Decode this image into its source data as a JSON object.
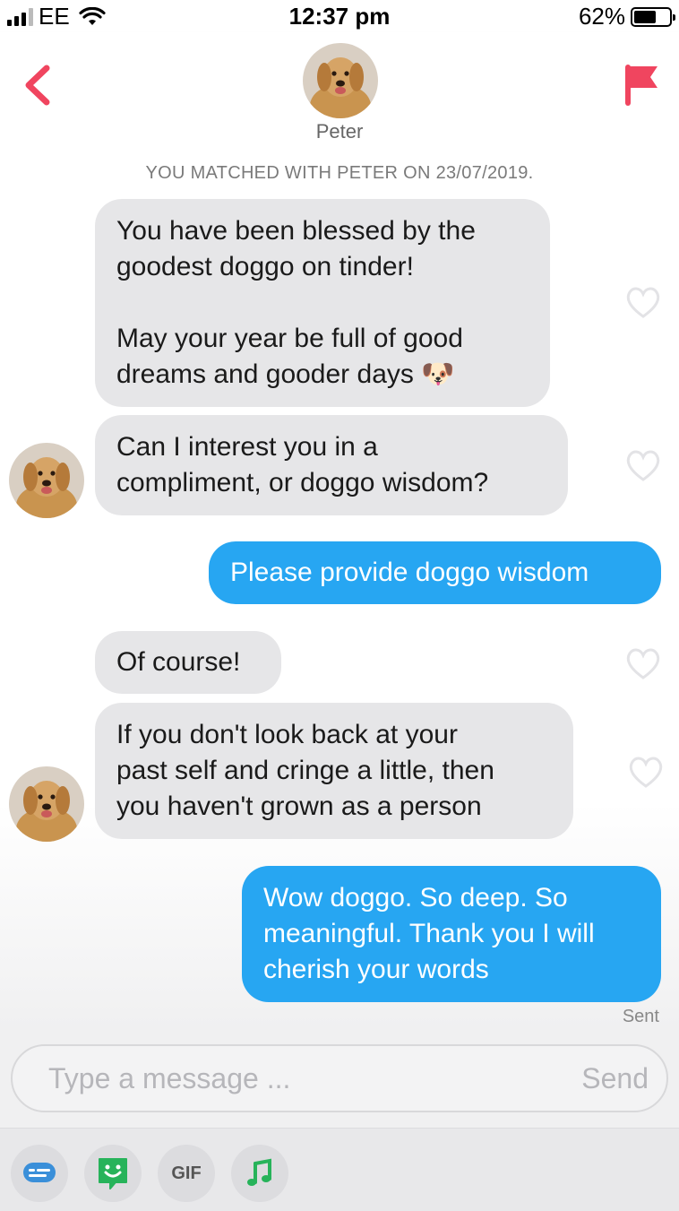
{
  "status_bar": {
    "carrier": "EE",
    "time": "12:37 pm",
    "battery": "62%",
    "battery_level": 0.62
  },
  "header": {
    "back_icon": "chevron-left-icon",
    "flag_icon": "flag-icon",
    "profile_name": "Peter",
    "accent_color": "#f0455f"
  },
  "chat": {
    "match_notice": "YOU MATCHED WITH PETER ON 23/07/2019.",
    "messages": [
      {
        "direction": "in",
        "lines": [
          "You have been blessed by the",
          "goodest doggo on tinder!",
          "",
          "May your year be full of good",
          "dreams and gooder days"
        ],
        "emoji": "🐶"
      },
      {
        "direction": "in",
        "lines": [
          "Can I interest you in a",
          "compliment, or doggo wisdom?"
        ]
      },
      {
        "direction": "out",
        "lines": [
          "Please provide doggo wisdom"
        ]
      },
      {
        "direction": "in",
        "lines": [
          "Of course!"
        ]
      },
      {
        "direction": "in",
        "lines": [
          "If you don't look back at your",
          "past self and cringe a little, then",
          "you haven't grown as a person"
        ]
      },
      {
        "direction": "out",
        "lines": [
          "Wow doggo. So deep. So",
          "meaningful. Thank you I will",
          "cherish your words"
        ]
      }
    ],
    "sent_label": "Sent",
    "incoming_bubble_color": "#e6e6e8",
    "outgoing_bubble_color": "#27a6f2"
  },
  "composer": {
    "placeholder": "Type a message ...",
    "send_label": "Send"
  },
  "toolbar": {
    "items": [
      {
        "icon": "message-bubble-icon",
        "color": "#3a8fd9"
      },
      {
        "icon": "smiley-sticker-icon",
        "color": "#27b35a"
      },
      {
        "icon": "gif-icon",
        "label": "GIF"
      },
      {
        "icon": "music-note-icon",
        "color": "#27b35a"
      }
    ]
  }
}
